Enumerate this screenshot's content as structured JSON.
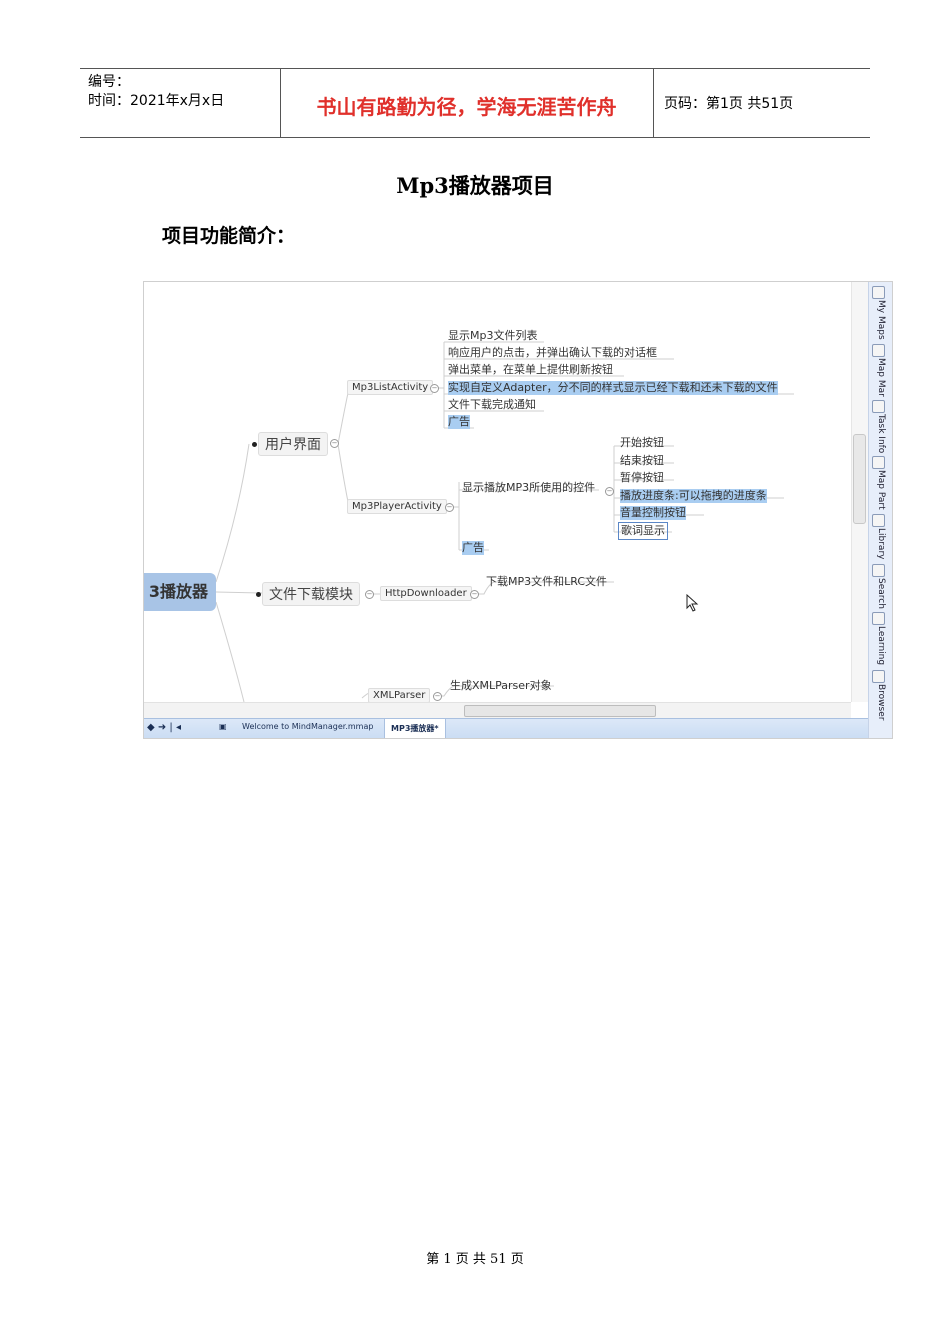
{
  "header": {
    "number_label": "编号：",
    "time_label": "时间：2021年x月x日",
    "motto": "书山有路勤为径，学海无涯苦作舟",
    "page_info": "页码：第1页  共51页"
  },
  "title": "Mp3播放器项目",
  "section_heading": "项目功能简介：",
  "mindmap": {
    "root": "3播放器",
    "ui_branch": "用户界面",
    "list_activity": "Mp3ListActivity",
    "list_items": [
      "显示Mp3文件列表",
      "响应用户的点击，并弹出确认下载的对话框",
      "弹出菜单，在菜单上提供刷新按钮",
      "实现自定义Adapter，分不同的样式显示已经下载和还未下载的文件",
      "文件下载完成通知",
      "广告"
    ],
    "player_activity": "Mp3PlayerActivity",
    "player_controls": "显示播放MP3所使用的控件",
    "player_ad": "广告",
    "controls": [
      "开始按钮",
      "结束按钮",
      "暂停按钮",
      "播放进度条:可以拖拽的进度条",
      "音量控制按钮",
      "歌词显示"
    ],
    "download_branch": "文件下载模块",
    "http_downloader": "HttpDownloader",
    "download_desc": "下载MP3文件和LRC文件",
    "xml_parser": "XMLParser",
    "xml_desc": "生成XMLParser对象"
  },
  "app_ui": {
    "tabs": [
      "Welcome to MindManager.mmap",
      "MP3播放器*"
    ],
    "side_panels": [
      "My Maps",
      "Map Mar",
      "Task Info",
      "Map Part",
      "Library",
      "Search",
      "Learning",
      "Browser"
    ]
  },
  "footer": "第 1 页 共 51 页"
}
